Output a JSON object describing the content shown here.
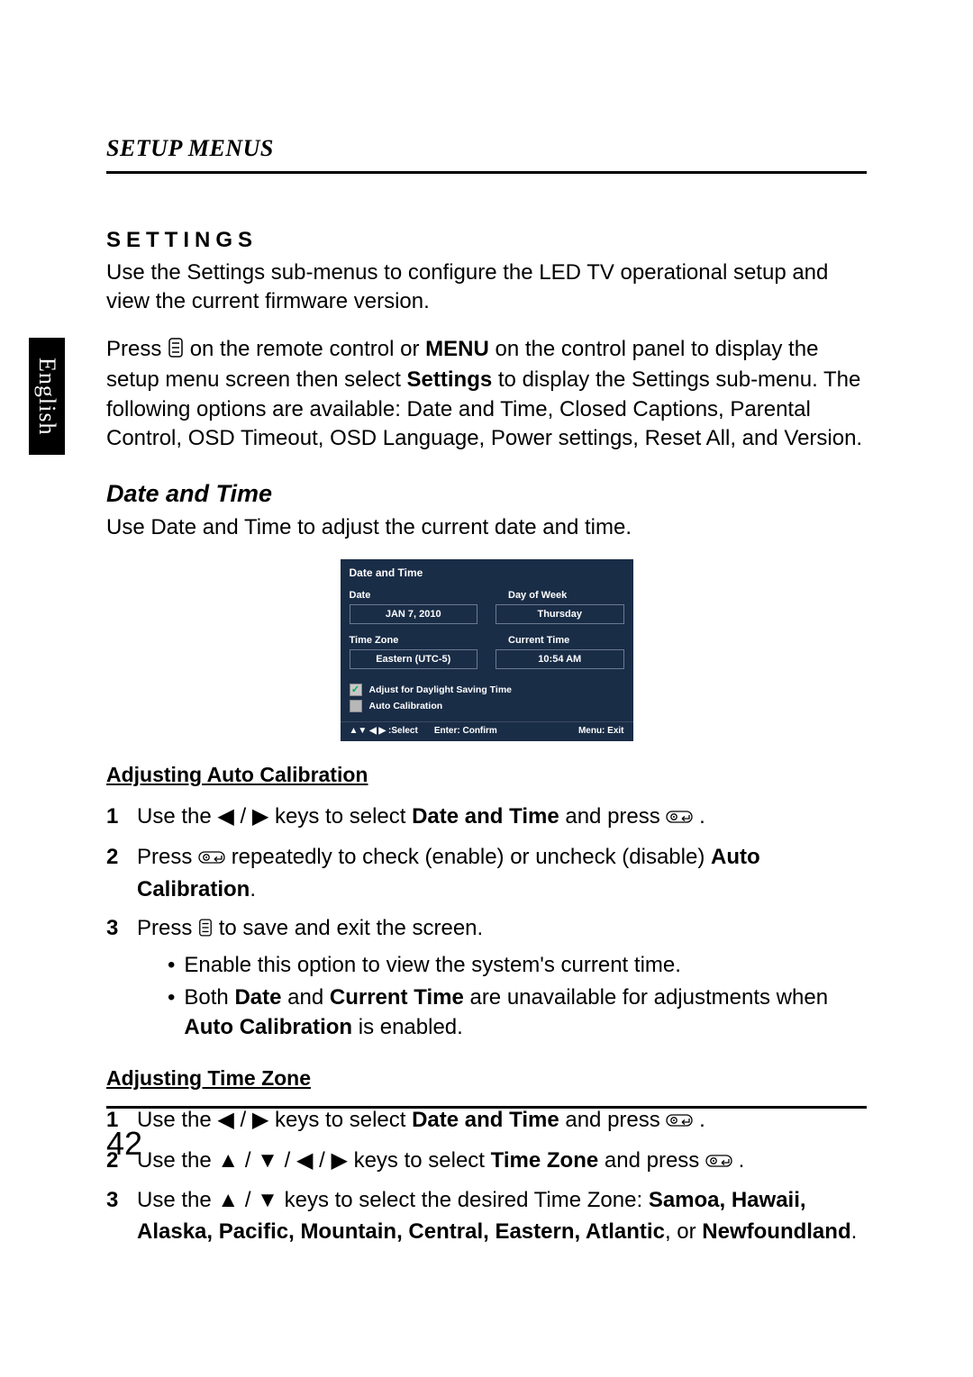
{
  "language_tab": "English",
  "header": "SETUP MENUS",
  "settings": {
    "heading": "SETTINGS",
    "para1": "Use the Settings sub-menus to configure the LED TV operational setup and view the current firmware version.",
    "para2_pre": "Press ",
    "para2_mid1": " on the remote control or ",
    "bold_menu": "MENU",
    "para2_mid2": " on the control panel to display the setup menu screen then select ",
    "bold_settings": "Settings",
    "para2_post": " to display the Settings sub-menu. The following options are available: Date and Time, Closed Captions, Parental Control, OSD Timeout, OSD Language, Power settings, Reset All, and Version."
  },
  "date_time": {
    "heading": "Date and Time",
    "intro": "Use Date and Time to adjust the current date and time."
  },
  "osd": {
    "title": "Date and Time",
    "date_label": "Date",
    "date_value": "JAN 7, 2010",
    "dow_label": "Day of Week",
    "dow_value": "Thursday",
    "tz_label": "Time Zone",
    "tz_value": "Eastern (UTC-5)",
    "ct_label": "Current Time",
    "ct_value": "10:54 AM",
    "check_dst": "Adjust for Daylight Saving Time",
    "check_auto": "Auto Calibration",
    "footer_select": "▲▼ ◀ ▶ :Select",
    "footer_confirm": "Enter: Confirm",
    "footer_exit": "Menu: Exit"
  },
  "autocal": {
    "heading": "Adjusting Auto Calibration",
    "s1_pre": "Use the ",
    "s1_mid": " keys to select ",
    "s1_bold": "Date and Time",
    "s1_post": " and press ",
    "s1_end": ".",
    "s2_pre": "Press ",
    "s2_mid": " repeatedly to check (enable) or uncheck (disable) ",
    "s2_bold": "Auto Calibration",
    "s2_end": ".",
    "s3_pre": "Press ",
    "s3_post": " to save and exit the screen.",
    "b1": "Enable this option to view the system's current time.",
    "b2_pre": "Both ",
    "b2_bold1": "Date",
    "b2_mid1": " and ",
    "b2_bold2": "Current Time",
    "b2_mid2": " are unavailable for adjustments when ",
    "b2_bold3": "Auto Calibration",
    "b2_post": " is enabled."
  },
  "tz": {
    "heading": "Adjusting Time Zone",
    "s1_pre": "Use the ",
    "s1_mid": " keys to select ",
    "s1_bold": "Date and Time",
    "s1_post": " and press ",
    "s1_end": ".",
    "s2_pre": "Use the ",
    "s2_mid": " keys to select ",
    "s2_bold": "Time Zone",
    "s2_post": " and press ",
    "s2_end": ".",
    "s3_pre": "Use the ",
    "s3_mid": " keys to select the desired Time Zone: ",
    "tz_list": "Samoa, Hawaii, Alaska, Pacific, Mountain, Central, Eastern, Atlantic",
    "s3_or": ", or ",
    "tz_last": "Newfoundland",
    "s3_end": "."
  },
  "page_number": "42",
  "glyph": {
    "left": "◀",
    "right": "▶",
    "up": "▲",
    "down": "▼",
    "slash": " / ",
    "bullet": "•"
  }
}
